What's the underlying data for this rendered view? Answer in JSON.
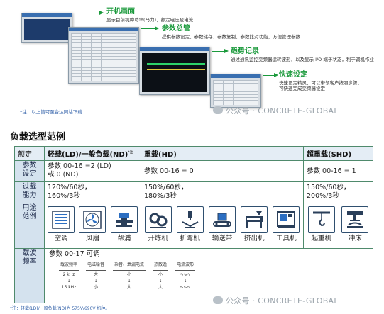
{
  "promo": {
    "callouts": [
      {
        "title": "开机画面",
        "desc": "显示目前机种功率(马力)，额定电压及电流"
      },
      {
        "title": "参数总管",
        "desc": "提供参数设定、参数储存、参数复制、参数比对功能，方便管理参数"
      },
      {
        "title": "趋势记录",
        "desc": "通过通讯监控变频器运转波形，以及显示 I/O 端子状态，利于调机作业"
      },
      {
        "title": "快速设定",
        "desc": "快速设定精灵，可以带领客户按照步骤，可快速完成变频器设定"
      }
    ],
    "note": "*注：以上皆可至台达网站下载",
    "watermark": "公众号 · CONCRETE-GLOBAL"
  },
  "section_title": "负载选型范例",
  "table": {
    "headers": {
      "corner": "额定",
      "light": "轻载(LD)/一般负载(ND)",
      "light_sup": "*注",
      "heavy": "重载(HD)",
      "super": "超重载(SHD)"
    },
    "param_row": {
      "label": "参数\n设定",
      "light_1": "参数 00-16 =2 (LD)",
      "light_2": "或 0 (ND)",
      "heavy": "参数 00-16 = 0",
      "super": "参数 00-16 = 1"
    },
    "overload_row": {
      "label": "过载\n能力",
      "light_1": "120%/60秒，",
      "light_2": "160%/3秒",
      "heavy_1": "150%/60秒，",
      "heavy_2": "180%/3秒",
      "super_1": "150%/60秒，",
      "super_2": "200%/3秒"
    },
    "apps_row": {
      "label": "用途\n范例",
      "light": [
        {
          "name": "空调",
          "icon": "air-conditioner-icon"
        },
        {
          "name": "风扇",
          "icon": "fan-icon"
        },
        {
          "name": "帮浦",
          "icon": "pump-icon"
        }
      ],
      "heavy": [
        {
          "name": "开炼机",
          "icon": "open-mill-icon"
        },
        {
          "name": "折弯机",
          "icon": "bending-machine-icon"
        },
        {
          "name": "输送带",
          "icon": "conveyor-belt-icon"
        },
        {
          "name": "挤出机",
          "icon": "extruder-icon"
        },
        {
          "name": "工具机",
          "icon": "machine-tool-icon"
        }
      ],
      "super": [
        {
          "name": "起重机",
          "icon": "crane-icon"
        },
        {
          "name": "冲床",
          "icon": "punch-press-icon"
        }
      ]
    },
    "carrier_row": {
      "label": "载波\n频率",
      "title": "参数 00-17 可调",
      "columns": [
        {
          "header": "载波频率",
          "values": [
            "2 kHz",
            "↓",
            "15 kHz"
          ]
        },
        {
          "header": "电磁噪音",
          "values": [
            "大",
            "↓",
            "小"
          ]
        },
        {
          "header": "杂音、泄漏电流",
          "values": [
            "小",
            "↓",
            "大"
          ]
        },
        {
          "header": "热散逸",
          "values": [
            "小",
            "↓",
            "大"
          ]
        },
        {
          "header": "电流波形",
          "values": [
            "∿∿∿",
            "↓",
            "∿∿∿"
          ]
        }
      ]
    }
  },
  "footnote": "*注：轻载(LD)/一般负载(ND)为 575V/690V 机种。",
  "footer_watermark": "公众号 · CONCRETE-GLOBAL"
}
